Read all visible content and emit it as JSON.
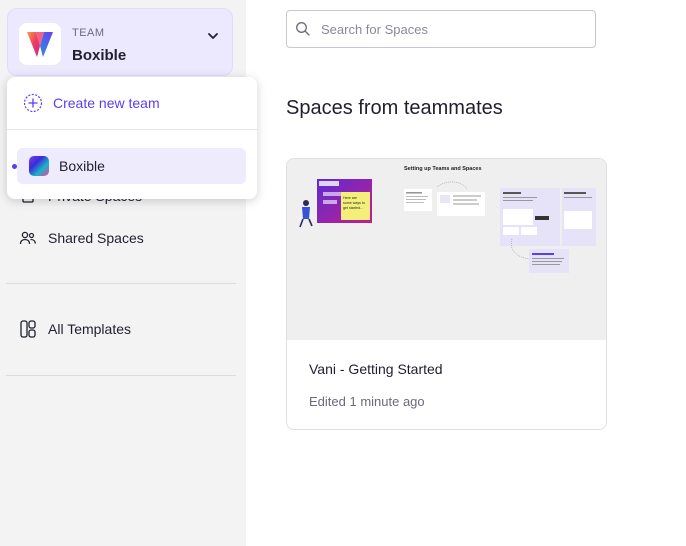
{
  "sidebar": {
    "team_kicker": "TEAM",
    "team_name": "Boxible",
    "nav": [
      {
        "label": "Private Spaces",
        "icon": "lock-icon"
      },
      {
        "label": "Shared Spaces",
        "icon": "people-icon"
      },
      {
        "label": "All Templates",
        "icon": "templates-icon"
      }
    ]
  },
  "dropdown": {
    "create_label": "Create new team",
    "teams": [
      {
        "label": "Boxible",
        "selected": true
      }
    ]
  },
  "search": {
    "placeholder": "Search for Spaces"
  },
  "main": {
    "section_title": "Spaces from teammates",
    "cards": [
      {
        "title": "Vani - Getting Started",
        "meta": "Edited 1 minute ago",
        "thumb_heading": "Setting up Teams and Spaces",
        "thumb_note": "Here are some ways to get started..."
      }
    ]
  },
  "colors": {
    "accent": "#5b3ef0",
    "sidebar_bg": "#f3f3f4",
    "team_switcher_bg": "#ece8fd"
  }
}
